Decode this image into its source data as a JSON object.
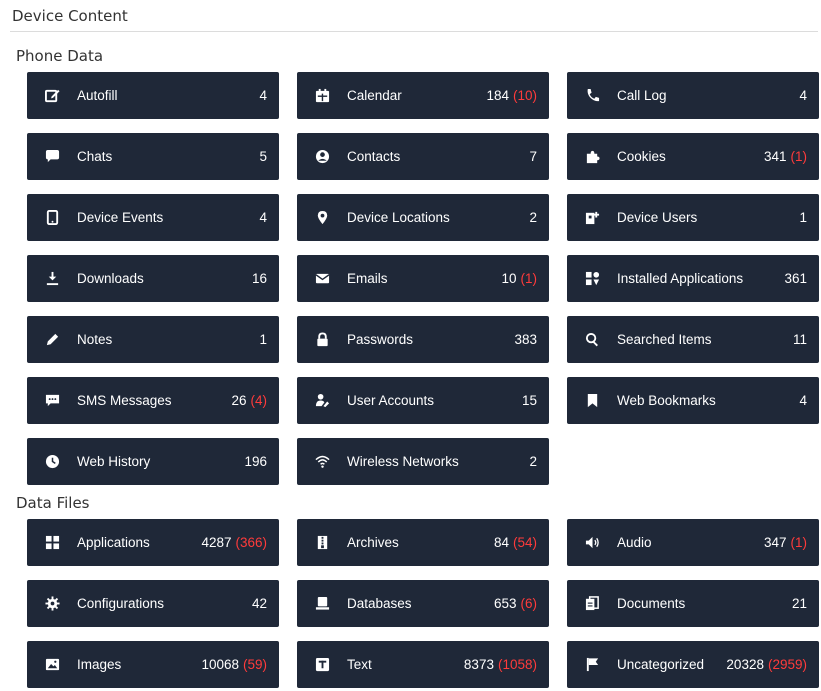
{
  "page": {
    "title": "Device Content"
  },
  "colors": {
    "tile_bg": "#1f2838",
    "flag": "#ff3b3b",
    "text": "#ffffff"
  },
  "phone_data": {
    "label": "Phone Data",
    "items": [
      {
        "label": "Autofill",
        "count": "4",
        "flag": "",
        "icon": "edit-square-icon"
      },
      {
        "label": "Calendar",
        "count": "184",
        "flag": "(10)",
        "icon": "calendar-icon"
      },
      {
        "label": "Call Log",
        "count": "4",
        "flag": "",
        "icon": "phone-icon"
      },
      {
        "label": "Chats",
        "count": "5",
        "flag": "",
        "icon": "chat-icon"
      },
      {
        "label": "Contacts",
        "count": "7",
        "flag": "",
        "icon": "user-circle-icon"
      },
      {
        "label": "Cookies",
        "count": "341",
        "flag": "(1)",
        "icon": "puzzle-icon"
      },
      {
        "label": "Device Events",
        "count": "4",
        "flag": "",
        "icon": "tablet-icon"
      },
      {
        "label": "Device Locations",
        "count": "2",
        "flag": "",
        "icon": "map-pin-icon"
      },
      {
        "label": "Device Users",
        "count": "1",
        "flag": "",
        "icon": "user-plus-icon"
      },
      {
        "label": "Downloads",
        "count": "16",
        "flag": "",
        "icon": "download-icon"
      },
      {
        "label": "Emails",
        "count": "10",
        "flag": "(1)",
        "icon": "envelope-icon"
      },
      {
        "label": "Installed Applications",
        "count": "361",
        "flag": "",
        "icon": "apps-icon"
      },
      {
        "label": "Notes",
        "count": "1",
        "flag": "",
        "icon": "pencil-icon"
      },
      {
        "label": "Passwords",
        "count": "383",
        "flag": "",
        "icon": "lock-icon"
      },
      {
        "label": "Searched Items",
        "count": "11",
        "flag": "",
        "icon": "search-icon"
      },
      {
        "label": "SMS Messages",
        "count": "26",
        "flag": "(4)",
        "icon": "message-icon"
      },
      {
        "label": "User Accounts",
        "count": "15",
        "flag": "",
        "icon": "user-key-icon"
      },
      {
        "label": "Web Bookmarks",
        "count": "4",
        "flag": "",
        "icon": "bookmark-icon"
      },
      {
        "label": "Web History",
        "count": "196",
        "flag": "",
        "icon": "clock-icon"
      },
      {
        "label": "Wireless Networks",
        "count": "2",
        "flag": "",
        "icon": "wifi-icon"
      }
    ]
  },
  "data_files": {
    "label": "Data Files",
    "items": [
      {
        "label": "Applications",
        "count": "4287",
        "flag": "(366)",
        "icon": "grid-icon"
      },
      {
        "label": "Archives",
        "count": "84",
        "flag": "(54)",
        "icon": "archive-icon"
      },
      {
        "label": "Audio",
        "count": "347",
        "flag": "(1)",
        "icon": "speaker-icon"
      },
      {
        "label": "Configurations",
        "count": "42",
        "flag": "",
        "icon": "gear-icon"
      },
      {
        "label": "Databases",
        "count": "653",
        "flag": "(6)",
        "icon": "database-icon"
      },
      {
        "label": "Documents",
        "count": "21",
        "flag": "",
        "icon": "documents-icon"
      },
      {
        "label": "Images",
        "count": "10068",
        "flag": "(59)",
        "icon": "image-icon"
      },
      {
        "label": "Text",
        "count": "8373",
        "flag": "(1058)",
        "icon": "text-icon"
      },
      {
        "label": "Uncategorized",
        "count": "20328",
        "flag": "(2959)",
        "icon": "flag-icon"
      }
    ]
  }
}
